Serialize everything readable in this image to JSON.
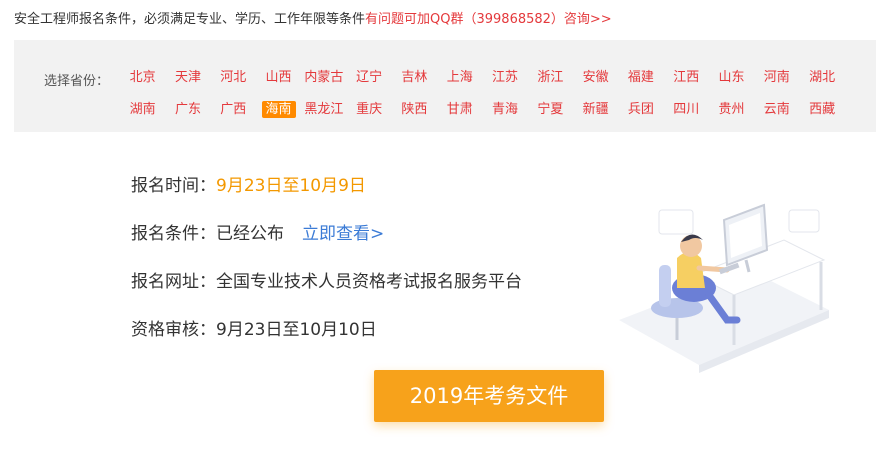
{
  "notice": {
    "text": "安全工程师报名条件，必须满足专业、学历、工作年限等条件",
    "link": "有问题可加QQ群（399868582）咨询>>"
  },
  "province_label": "选择省份：",
  "provinces_row1": [
    "北京",
    "天津",
    "河北",
    "山西",
    "内蒙古",
    "辽宁",
    "吉林",
    "上海",
    "江苏",
    "浙江",
    "安徽",
    "福建",
    "江西",
    "山东",
    "河南",
    "湖北"
  ],
  "provinces_row2": [
    "湖南",
    "广东",
    "广西",
    "海南",
    "黑龙江",
    "重庆",
    "陕西",
    "甘肃",
    "青海",
    "宁夏",
    "新疆",
    "兵团",
    "四川",
    "贵州",
    "云南",
    "西藏"
  ],
  "active_province": "海南",
  "info": {
    "time_label": "报名时间：",
    "time_value": "9月23日至10月9日",
    "cond_label": "报名条件：",
    "cond_value": "已经公布",
    "cond_link": "立即查看>",
    "site_label": "报名网址：",
    "site_value": "全国专业技术人员资格考试报名服务平台",
    "review_label": "资格审核：",
    "review_value": "9月23日至10月10日"
  },
  "cta_label": "2019年考务文件",
  "colors": {
    "red": "#e4393c",
    "orange": "#f39800",
    "button": "#f7a21b",
    "link": "#3b7bd6"
  }
}
